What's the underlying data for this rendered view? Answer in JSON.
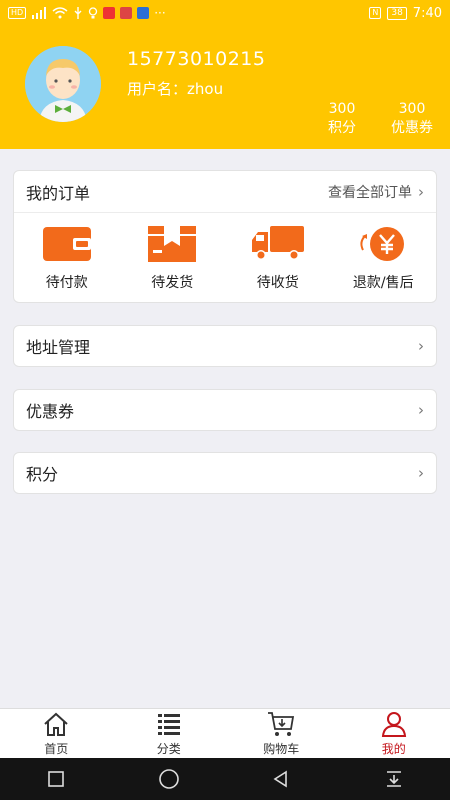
{
  "status_bar": {
    "left_icons": [
      "hd-icon",
      "signal-icon",
      "wifi-icon",
      "usb-icon",
      "bulb-icon",
      "app-icon-red",
      "app-icon-red2",
      "translate-icon",
      "more-icon"
    ],
    "hd": "HD",
    "more": "···",
    "nfc": "N",
    "battery": "38",
    "time": "7:40"
  },
  "colors": {
    "header_bg": "#ffc600",
    "order_icon": "#f26a1b",
    "active_tab": "#c4161c",
    "page_bg": "#efeff4"
  },
  "profile": {
    "phone": "15773010215",
    "username_label": "用户名：",
    "username": "zhou",
    "points_value": "300",
    "points_label": "积分",
    "coupons_value": "300",
    "coupons_label": "优惠券"
  },
  "orders": {
    "title": "我的订单",
    "view_all": "查看全部订单",
    "items": [
      {
        "label": "待付款",
        "icon": "wallet-icon"
      },
      {
        "label": "待发货",
        "icon": "package-icon"
      },
      {
        "label": "待收货",
        "icon": "truck-icon"
      },
      {
        "label": "退款/售后",
        "icon": "yen-refund-icon"
      }
    ]
  },
  "menu": {
    "address": "地址管理",
    "coupons": "优惠券",
    "points": "积分"
  },
  "tabs": [
    {
      "label": "首页",
      "icon": "home-icon"
    },
    {
      "label": "分类",
      "icon": "list-icon"
    },
    {
      "label": "购物车",
      "icon": "cart-icon"
    },
    {
      "label": "我的",
      "icon": "user-icon",
      "active": true
    }
  ],
  "android_nav": [
    "recent-apps-icon",
    "home-circle-icon",
    "back-icon",
    "notification-down-icon"
  ]
}
